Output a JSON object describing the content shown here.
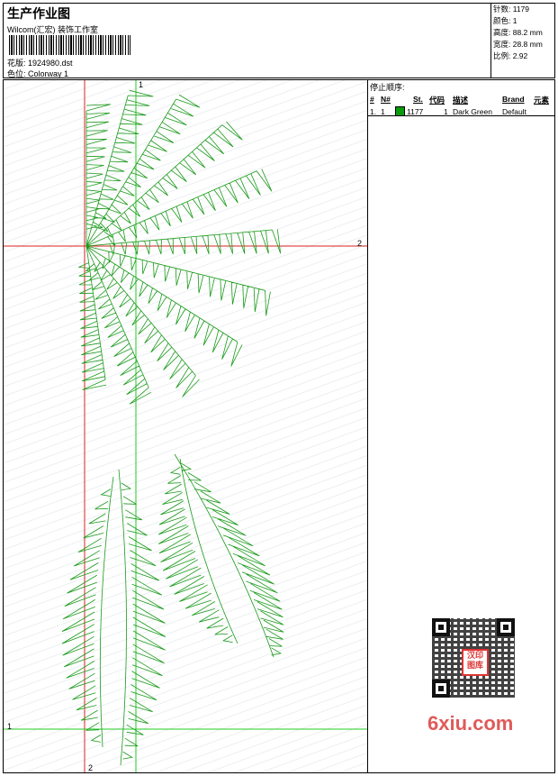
{
  "header": {
    "title": "生产作业图",
    "studio": "Wilcom(汇宏) 装饰工作室",
    "design_label": "花版: 1924980.dst",
    "colorway_label": "色位: Colorway 1"
  },
  "stats": {
    "stitches": "针数: 1179",
    "colors": "颜色: 1",
    "height": "高度: 88.2 mm",
    "width": "宽度: 28.8 mm",
    "scale": "比例: 2.92"
  },
  "stop_sequence": {
    "title": "停止顺序:",
    "columns": [
      "#",
      "N#",
      "St.",
      "代码",
      "描述",
      "Brand",
      "元素"
    ],
    "rows": [
      {
        "index": "1.",
        "needle": "1",
        "stitches": "1177",
        "code": "1",
        "description": "Dark Green",
        "brand": "Default",
        "color": "#0a9a0a"
      }
    ]
  },
  "axes": {
    "top_marker": "1",
    "right_marker": "2",
    "left_marker": "1",
    "bottom_marker": "2"
  },
  "colors": {
    "stitch": "#1a9a1a",
    "axis_red": "#d22",
    "axis_green": "#2c2"
  },
  "watermark": {
    "stamp": "汉印图库",
    "site": "6xiu.com"
  }
}
